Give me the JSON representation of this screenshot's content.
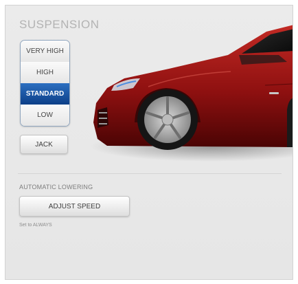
{
  "title": "SUSPENSION",
  "levels": {
    "very_high": "VERY HIGH",
    "high": "HIGH",
    "standard": "STANDARD",
    "low": "LOW",
    "selected": "STANDARD"
  },
  "jack_label": "JACK",
  "automatic_lowering": {
    "heading": "AUTOMATIC LOWERING",
    "button_label": "ADJUST SPEED",
    "hint": "Set to ALWAYS"
  },
  "colors": {
    "selected_level": "#0d3f88",
    "car_body": "#8e1010"
  }
}
